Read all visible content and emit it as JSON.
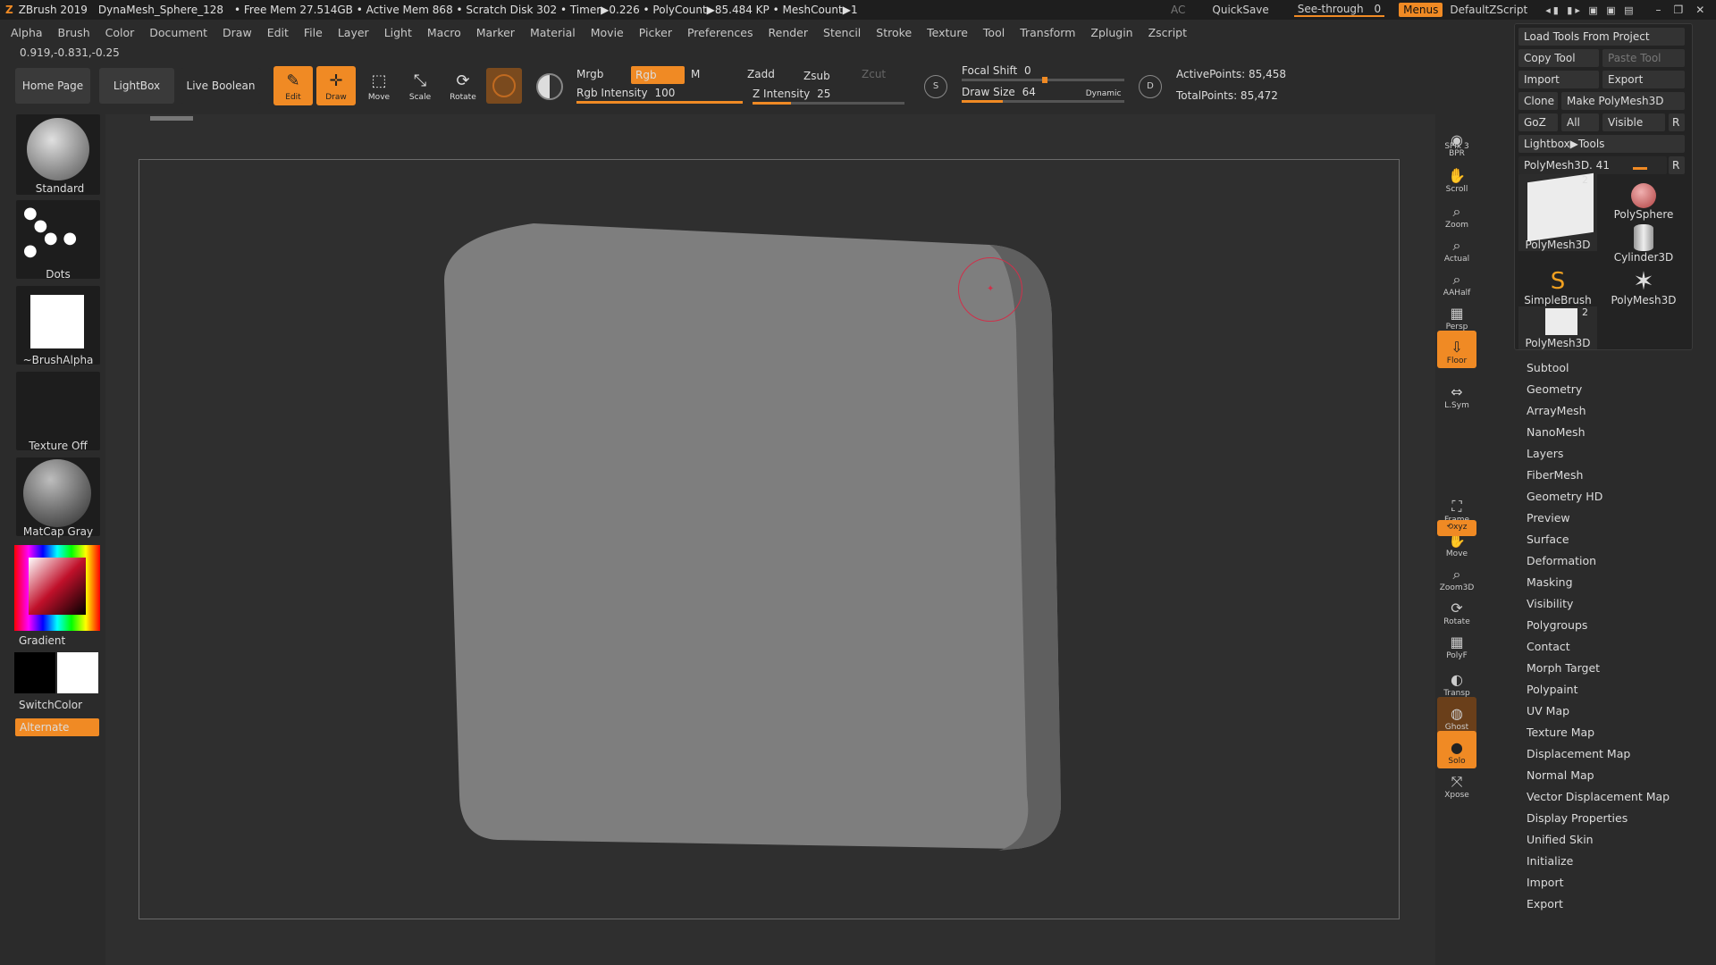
{
  "titlebar": {
    "app": "ZBrush 2019",
    "file": "DynaMesh_Sphere_128",
    "status": "• Free Mem 27.514GB • Active Mem 868 • Scratch Disk 302 • Timer▶0.226 • PolyCount▶85.484 KP • MeshCount▶1",
    "ac": "AC",
    "quicksave": "QuickSave",
    "see_through": "See-through",
    "see_through_value": "0",
    "menus": "Menus",
    "zscript": "DefaultZScript"
  },
  "menubar": [
    "Alpha",
    "Brush",
    "Color",
    "Document",
    "Draw",
    "Edit",
    "File",
    "Layer",
    "Light",
    "Macro",
    "Marker",
    "Material",
    "Movie",
    "Picker",
    "Preferences",
    "Render",
    "Stencil",
    "Stroke",
    "Texture",
    "Tool",
    "Transform",
    "Zplugin",
    "Zscript"
  ],
  "coords": "0.919,-0.831,-0.25",
  "shelf": {
    "home": "Home Page",
    "lightbox": "LightBox",
    "live_boolean": "Live Boolean",
    "tools": [
      {
        "label": "Edit",
        "icon": "edit-icon"
      },
      {
        "label": "Draw",
        "icon": "draw-icon"
      },
      {
        "label": "Move",
        "icon": "move-icon"
      },
      {
        "label": "Scale",
        "icon": "scale-icon"
      },
      {
        "label": "Rotate",
        "icon": "rotate-icon"
      }
    ],
    "mrgb": "Mrgb",
    "rgb": "Rgb",
    "m": "M",
    "rgb_intensity": "Rgb Intensity",
    "rgb_intensity_value": "100",
    "zadd": "Zadd",
    "zsub": "Zsub",
    "zcut": "Zcut",
    "z_intensity": "Z Intensity",
    "z_intensity_value": "25",
    "focal_shift": "Focal Shift",
    "focal_shift_value": "0",
    "draw_size": "Draw Size",
    "draw_size_value": "64",
    "dynamic": "Dynamic",
    "active_points": "ActivePoints: 85,458",
    "total_points": "TotalPoints: 85,472"
  },
  "leftpanel": {
    "brush": "Standard",
    "stroke": "Dots",
    "alpha": "~BrushAlpha",
    "texture": "Texture Off",
    "material": "MatCap Gray",
    "gradient": "Gradient",
    "switchcolor": "SwitchColor",
    "alternate": "Alternate"
  },
  "rail": [
    {
      "label": "BPR"
    },
    {
      "label": "SPix 3"
    },
    {
      "label": "Scroll"
    },
    {
      "label": "Zoom"
    },
    {
      "label": "Actual"
    },
    {
      "label": "AAHalf"
    },
    {
      "label": "Persp"
    },
    {
      "label": "Floor"
    },
    {
      "label": "L.Sym"
    },
    {
      "label": "Frame"
    },
    {
      "label": "Move"
    },
    {
      "label": "Zoom3D"
    },
    {
      "label": "Rotate"
    },
    {
      "label": "PolyF"
    },
    {
      "label": "Transp"
    },
    {
      "label": "Ghost"
    },
    {
      "label": "Solo"
    },
    {
      "label": "Xpose"
    }
  ],
  "toolpanel": {
    "load_tools": "Load Tools From Project",
    "copy_tool": "Copy Tool",
    "paste_tool": "Paste Tool",
    "import": "Import",
    "export": "Export",
    "clone": "Clone",
    "make_polymesh": "Make PolyMesh3D",
    "goz": "GoZ",
    "all": "All",
    "visible": "Visible",
    "r": "R",
    "lightbox_tools": "Lightbox▶Tools",
    "current_tool": "PolyMesh3D. 41",
    "thumbs": [
      {
        "label": "PolyMesh3D",
        "badge": "2"
      },
      {
        "label": "PolySphere",
        "badge": ""
      },
      {
        "label": "Cylinder3D",
        "badge": ""
      },
      {
        "label": "SimpleBrush",
        "badge": ""
      },
      {
        "label": "PolyMesh3D",
        "badge": ""
      },
      {
        "label": "PolyMesh3D",
        "badge": "2"
      }
    ]
  },
  "subpalettes": [
    "Subtool",
    "Geometry",
    "ArrayMesh",
    "NanoMesh",
    "Layers",
    "FiberMesh",
    "Geometry HD",
    "Preview",
    "Surface",
    "Deformation",
    "Masking",
    "Visibility",
    "Polygroups",
    "Contact",
    "Morph Target",
    "Polypaint",
    "UV Map",
    "Texture Map",
    "Displacement Map",
    "Normal Map",
    "Vector Displacement Map",
    "Display Properties",
    "Unified Skin",
    "Initialize",
    "Import",
    "Export"
  ],
  "colors": {
    "accent": "#f08a24",
    "bg": "#2b2b2b",
    "mesh": "#7e7e7e"
  }
}
